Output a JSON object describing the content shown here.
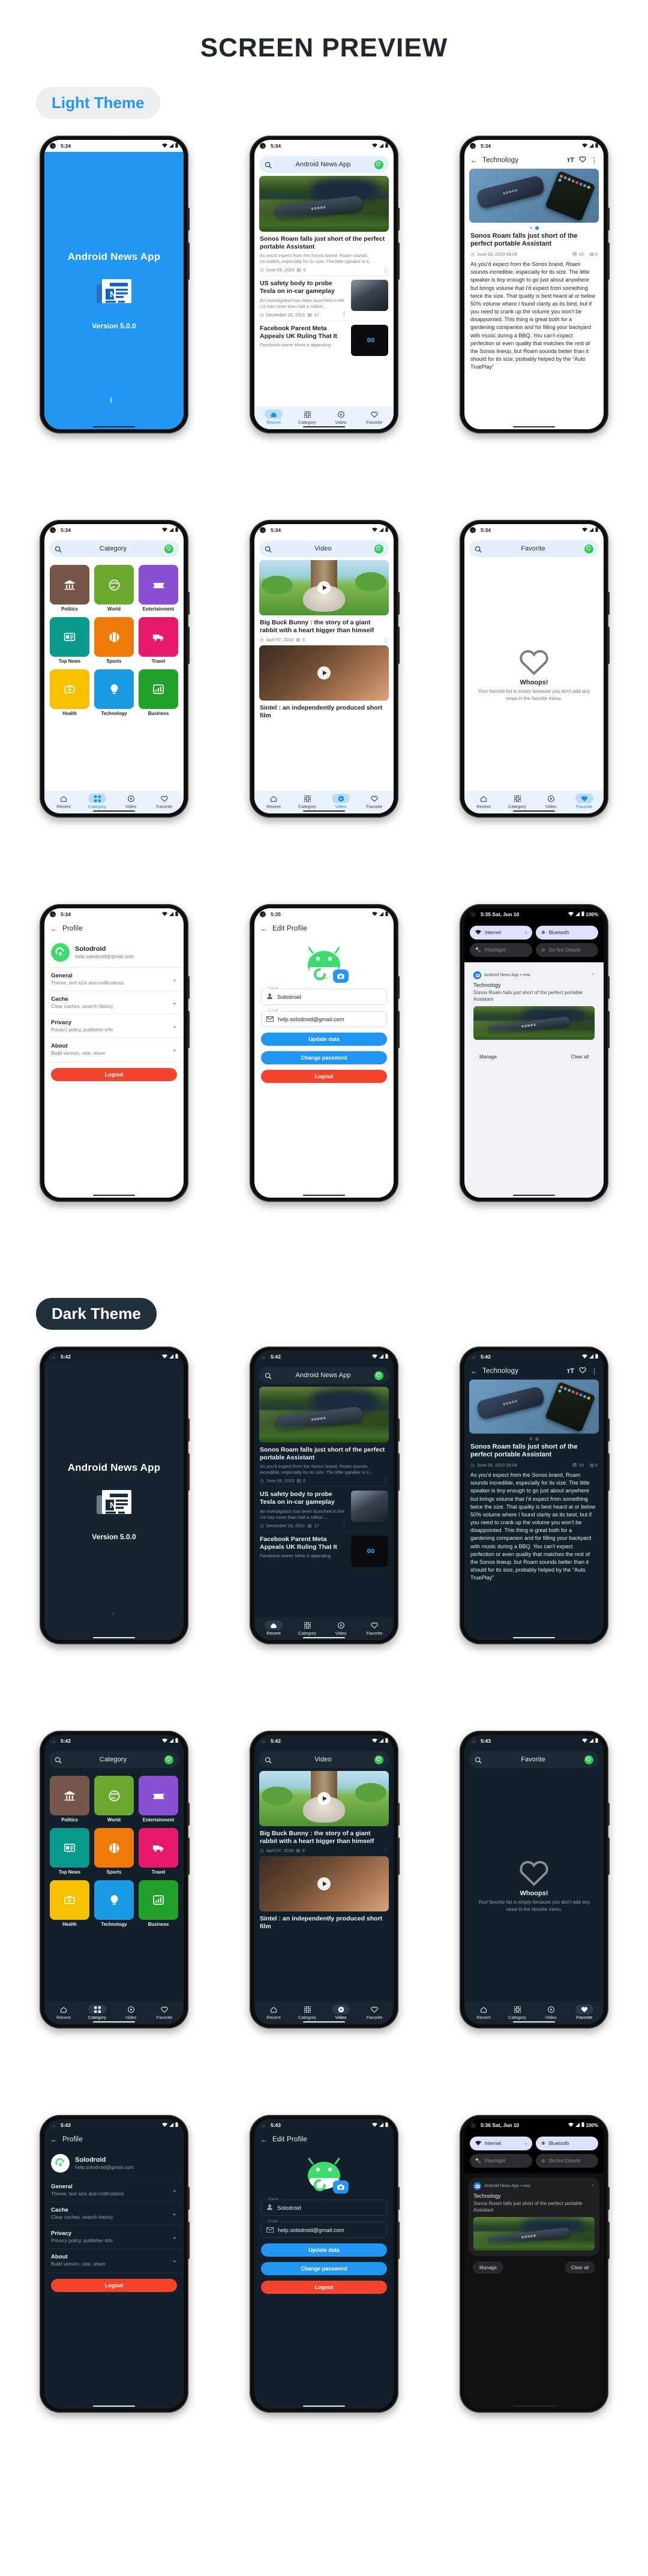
{
  "page": {
    "title": "SCREEN PREVIEW",
    "light_theme_label": "Light Theme",
    "dark_theme_label": "Dark Theme"
  },
  "app": {
    "name": "Android News App",
    "version": "Version 5.0.0"
  },
  "status_bar": {
    "time_light": "5:34",
    "time_light_edit": "5:35",
    "time_light_shade": "5:35 Sat, Jun 10",
    "time_dark": "5:42",
    "time_dark_profile": "5:43",
    "time_dark_shade": "5:36 Sat, Jun 10",
    "battery_percent": "100%"
  },
  "search": {
    "placeholder_home": "Android News App",
    "title_category": "Category",
    "title_video": "Video",
    "title_favorite": "Favorite"
  },
  "bottom_nav": [
    {
      "label": "Recent",
      "icon": "home-icon"
    },
    {
      "label": "Category",
      "icon": "grid-icon"
    },
    {
      "label": "Video",
      "icon": "play-circle-icon"
    },
    {
      "label": "Favorite",
      "icon": "heart-icon"
    }
  ],
  "news_list": [
    {
      "title": "Sonos Roam falls just short of the perfect portable Assistant",
      "desc": "As you'd expect from the Sonos brand, Roam sounds incredible, especially for its size. The little speaker is ti...",
      "date": "June 09, 2023",
      "comments": "0"
    },
    {
      "title": "US safety body to probe Tesla on in-car gameplay",
      "desc": "An investigation has been launched in the US into more than half a million ...",
      "date": "December 26, 2021",
      "comments": "17"
    },
    {
      "title": "Facebook Parent Meta Appeals UK Ruling That It",
      "desc": "Facebook-owner Meta is appealing",
      "date": "",
      "comments": ""
    }
  ],
  "detail": {
    "category": "Technology",
    "title": "Sonos Roam falls just short of the perfect portable Assistant",
    "date": "June 09, 2023 09:04",
    "views_light": "15",
    "views_dark": "16",
    "comments": "0",
    "body": "As you'd expect from the Sonos brand, Roam sounds incredible, especially for its size. The little speaker is tiny enough to go just about anywhere but brings volume that I'd expect from something twice the size. That quality is best heard at or below 50% volume where I found clarity as its best, but if you need to crank up the volume you won't be disappointed. This thing is great both for a gardening companion and for filling your backyard with music during a BBQ. You can't expect perfection or even quality that matches the rest of the Sonos lineup, but Roam sounds better than it should for its size, probably helped by the \"Auto TruePlay\"",
    "actions": {
      "text_size": "text-size-icon",
      "favorite": "heart-icon",
      "more": "more-vertical-icon"
    }
  },
  "categories": [
    {
      "label": "Politics",
      "color": "#77564a",
      "icon": "bank-icon"
    },
    {
      "label": "World",
      "color": "#6aa82e",
      "icon": "globe-icon"
    },
    {
      "label": "Entertainment",
      "color": "#8b4fd6",
      "icon": "ticket-icon"
    },
    {
      "label": "Top News",
      "color": "#0a9a8c",
      "icon": "article-icon"
    },
    {
      "label": "Sports",
      "color": "#f07a08",
      "icon": "ball-icon"
    },
    {
      "label": "Travel",
      "color": "#e8186a",
      "icon": "truck-icon"
    },
    {
      "label": "Health",
      "color": "#f7c101",
      "icon": "medkit-icon"
    },
    {
      "label": "Technology",
      "color": "#1b9ae4",
      "icon": "bulb-icon"
    },
    {
      "label": "Business",
      "color": "#22a12a",
      "icon": "chart-icon"
    }
  ],
  "videos": [
    {
      "title": "Big Buck Bunny : the story of a giant rabbit with a heart bigger than himself",
      "date": "April 07, 2018",
      "comments": "6"
    },
    {
      "title": "Sintel : an independently produced short film",
      "date": "",
      "comments": ""
    }
  ],
  "favorite_empty": {
    "heading": "Whoops!",
    "message": "Your favorite list is empty because you don't add any news in the favorite menu."
  },
  "profile": {
    "title": "Profile",
    "user_name": "Solodroid",
    "user_email": "help.solodroid@gmail.com",
    "sections": [
      {
        "title": "General",
        "subtitle": "Theme, text size and notifications"
      },
      {
        "title": "Cache",
        "subtitle": "Clear caches, search history"
      },
      {
        "title": "Privacy",
        "subtitle": "Privacy policy, publisher info"
      },
      {
        "title": "About",
        "subtitle": "Build version, rate, share"
      }
    ],
    "logout_label": "Logout"
  },
  "edit_profile": {
    "title": "Edit Profile",
    "name_label": "Name",
    "name_value": "Solodroid",
    "email_label": "Email",
    "email_value": "help.solodroid@gmail.com",
    "update_label": "Update data",
    "change_password_label": "Change password",
    "logout_label": "Logout"
  },
  "notification_shade": {
    "tiles": [
      {
        "label": "Internet",
        "state": "on",
        "icon": "wifi-icon"
      },
      {
        "label": "Bluetooth",
        "state": "on",
        "icon": "bluetooth-icon"
      },
      {
        "label": "Flashlight",
        "state": "off",
        "icon": "flashlight-icon"
      },
      {
        "label": "Do Not Disturb",
        "state": "off",
        "icon": "dnd-icon"
      }
    ],
    "app_line": "Android News App  •  now",
    "category": "Technology",
    "text": "Sonos Roam falls just short of the perfect portable Assistant",
    "manage_label": "Manage",
    "clear_all_label": "Clear all"
  },
  "colors": {
    "brand_blue": "#2196f3",
    "danger_red": "#f4442e",
    "accent_green": "#3ddc6e",
    "dark_bg": "#131f2a"
  }
}
